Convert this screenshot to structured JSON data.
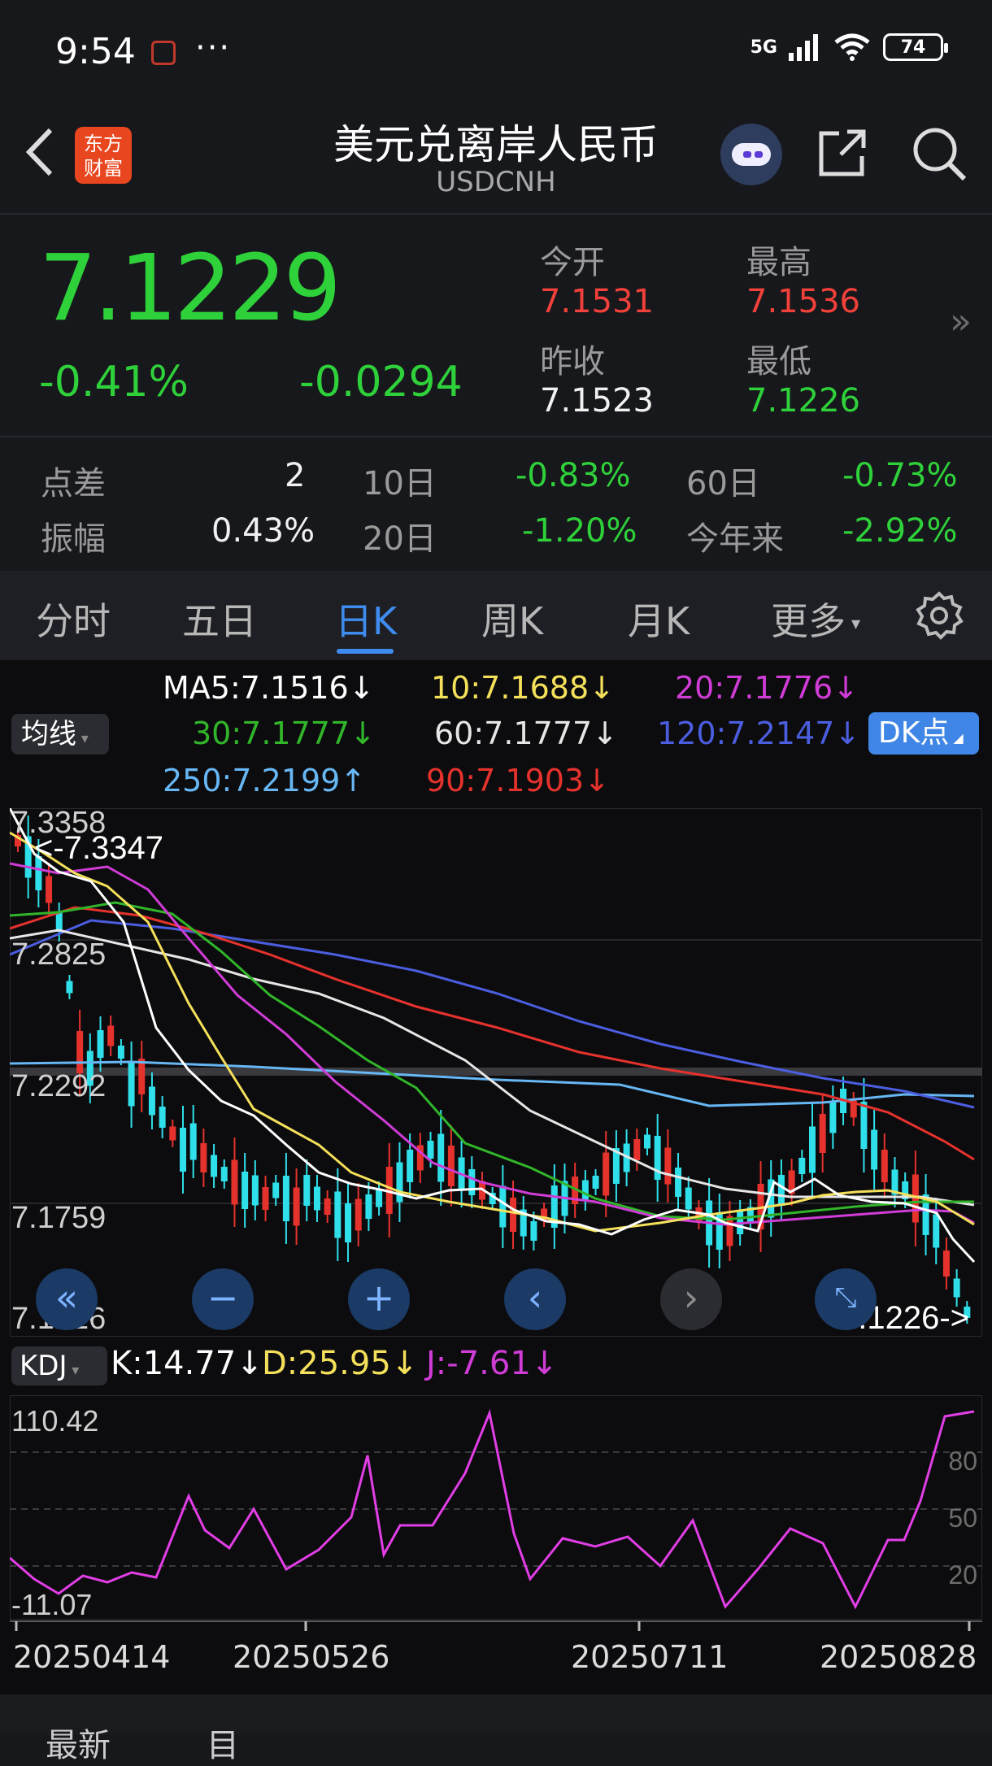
{
  "status_bar": {
    "time": "9:54",
    "dots": "···",
    "network": "5G",
    "battery": "74"
  },
  "nav": {
    "back_icon": "chevron-left-icon",
    "logo_text": "东方财富",
    "title": "美元兑离岸人民币",
    "subtitle": "USDCNH"
  },
  "quote": {
    "price": "7.1229",
    "change_pct": "-0.41%",
    "change": "-0.0294",
    "open_label": "今开",
    "open": "7.1531",
    "high_label": "最高",
    "high": "7.1536",
    "prev_close_label": "昨收",
    "prev_close": "7.1523",
    "low_label": "最低",
    "low": "7.1226",
    "more_icon": "»"
  },
  "stats": {
    "spread_label": "点差",
    "spread": "2",
    "d10_label": "10日",
    "d10": "-0.83%",
    "d60_label": "60日",
    "d60": "-0.73%",
    "amp_label": "振幅",
    "amp": "0.43%",
    "d20_label": "20日",
    "d20": "-1.20%",
    "ytd_label": "今年来",
    "ytd": "-2.92%"
  },
  "tabs": [
    {
      "label": "分时"
    },
    {
      "label": "五日"
    },
    {
      "label": "日K"
    },
    {
      "label": "周K"
    },
    {
      "label": "月K"
    },
    {
      "label": "更多"
    }
  ],
  "active_tab": "日K",
  "ma": {
    "badge": "均线",
    "ma5": "MA5:7.1516↓",
    "ma10": "10:7.1688↓",
    "ma20": "20:7.1776↓",
    "ma30": "30:7.1777↓",
    "ma60": "60:7.1777↓",
    "ma120": "120:7.2147↓",
    "ma250": "250:7.2199↑",
    "ma90": "90:7.1903↓",
    "dk_button": "DK点"
  },
  "main_chart": {
    "y_labels": [
      "7.3358",
      "7.2825",
      "7.2292",
      "7.1759",
      "7.1226"
    ],
    "max_marker": "<-7.3347",
    "min_marker": "7.1226->"
  },
  "kdj": {
    "badge": "KDJ",
    "k": "K:14.77↓",
    "d": "D:25.95↓",
    "j": "J:-7.61↓",
    "y_top": "110.42",
    "y_bottom": "-11.07",
    "ref_levels": [
      "80",
      "50",
      "20"
    ]
  },
  "x_dates": [
    "20250414",
    "20250526",
    "20250711",
    "20250828"
  ],
  "bottom": {
    "left": "最新",
    "mid": "目"
  },
  "colors": {
    "up": "#f2403a",
    "down": "#2fd13a",
    "accent": "#3f8cf0"
  }
}
